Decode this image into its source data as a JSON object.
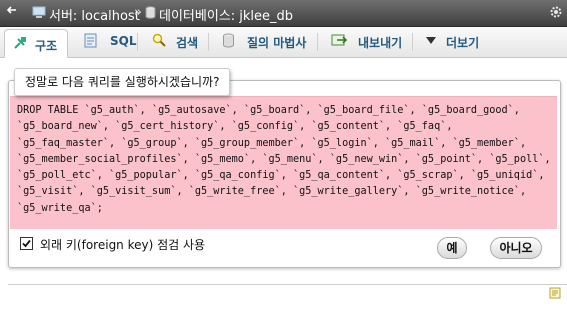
{
  "topbar": {
    "server_label": "서버: localhost",
    "separator": "»",
    "db_label": "데이터베이스: jklee_db"
  },
  "tabs": [
    {
      "label": "구조",
      "icon": "structure-icon"
    },
    {
      "label": "SQL",
      "icon": "sql-icon"
    },
    {
      "label": "검색",
      "icon": "search-icon"
    },
    {
      "label": "질의 마법사",
      "icon": "query-icon"
    },
    {
      "label": "내보내기",
      "icon": "export-icon"
    },
    {
      "label": "더보기",
      "icon": "chevron-down-icon"
    }
  ],
  "dialog": {
    "title": "정말로 다음 쿼리를 실행하시겠습니까?",
    "sql": "DROP TABLE `g5_auth`, `g5_autosave`, `g5_board`, `g5_board_file`, `g5_board_good`, `g5_board_new`, `g5_cert_history`, `g5_config`, `g5_content`, `g5_faq`, `g5_faq_master`, `g5_group`, `g5_group_member`, `g5_login`, `g5_mail`, `g5_member`, `g5_member_social_profiles`, `g5_memo`, `g5_menu`, `g5_new_win`, `g5_point`, `g5_poll`, `g5_poll_etc`, `g5_popular`, `g5_qa_config`, `g5_qa_content`, `g5_scrap`, `g5_uniqid`, `g5_visit`, `g5_visit_sum`, `g5_write_free`, `g5_write_gallery`, `g5_write_notice`, `g5_write_qa`;",
    "fk_label": "외래 키(foreign key) 점검 사용",
    "fk_checked": true,
    "yes_label": "예",
    "no_label": "아니오"
  }
}
